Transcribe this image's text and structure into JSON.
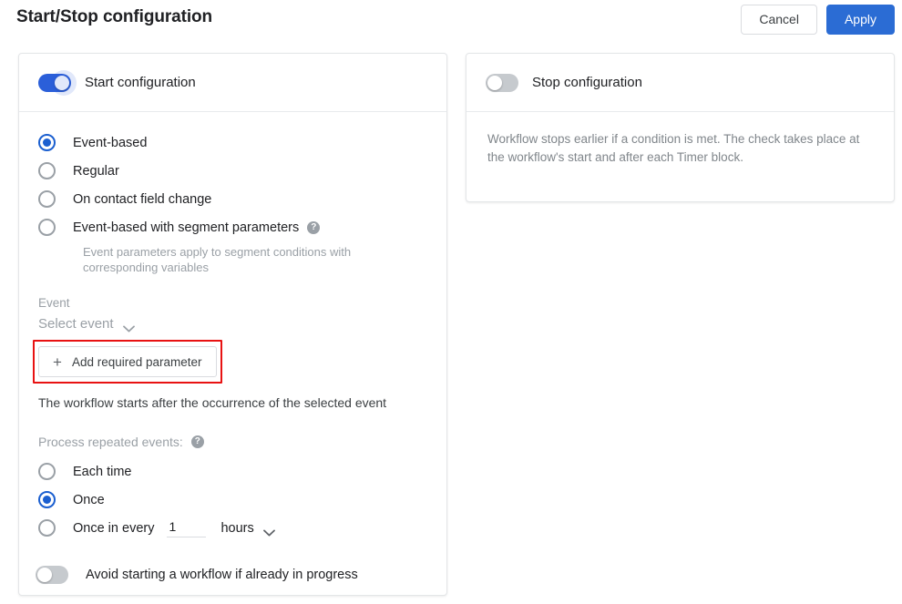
{
  "header": {
    "title": "Start/Stop configuration",
    "cancel_label": "Cancel",
    "apply_label": "Apply"
  },
  "start_card": {
    "toggle_label": "Start configuration",
    "toggle_state": "on",
    "trigger_options": [
      {
        "label": "Event-based",
        "checked": true
      },
      {
        "label": "Regular",
        "checked": false
      },
      {
        "label": "On contact field change",
        "checked": false
      },
      {
        "label": "Event-based with segment parameters",
        "checked": false,
        "help": "?"
      }
    ],
    "segment_hint": "Event parameters apply to segment conditions with corresponding variables",
    "event_field_label": "Event",
    "event_select_value": "Select event",
    "add_parameter_label": "Add required parameter",
    "add_parameter_plus": "+",
    "add_parameter_highlight_color": "#e81212",
    "start_note": "The workflow starts after the occurrence of the selected event",
    "repeat_label": "Process repeated events:",
    "repeat_help": "?",
    "repeat_options": [
      {
        "label": "Each time",
        "checked": false
      },
      {
        "label": "Once",
        "checked": true
      },
      {
        "label": "Once in every",
        "checked": false
      }
    ],
    "interval_value": "1",
    "interval_unit": "hours",
    "avoid_toggle_label": "Avoid starting a workflow if already in progress",
    "avoid_toggle_state": "off"
  },
  "stop_card": {
    "toggle_label": "Stop configuration",
    "toggle_state": "off",
    "description": "Workflow stops earlier if a condition is met. The check takes place at the workflow's start and after each Timer block."
  },
  "colors": {
    "accent_blue": "#2b6cd4",
    "toggle_on": "#2b5fd9",
    "radio_checked": "#1b5fd0",
    "highlight_red": "#e81212",
    "muted_text": "#9aa0a6"
  }
}
